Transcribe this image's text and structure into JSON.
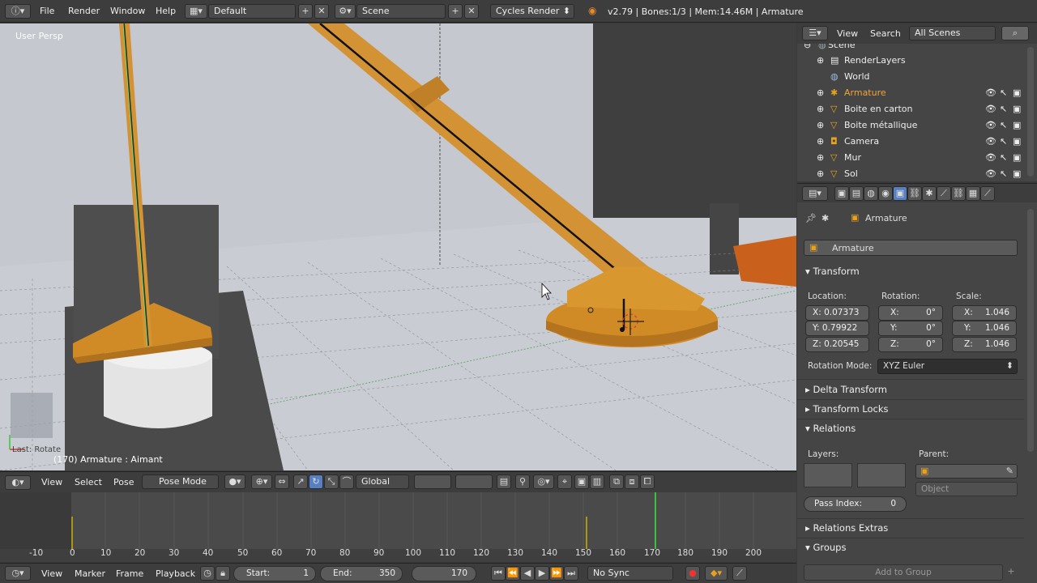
{
  "topbar": {
    "menus": [
      "File",
      "Render",
      "Window",
      "Help"
    ],
    "screen_layout": "Default",
    "scene": "Scene",
    "render_engine": "Cycles Render",
    "stats": "v2.79 | Bones:1/3 | Mem:14.46M | Armature"
  },
  "viewport": {
    "view_label": "User Persp",
    "last_op": "Last: Rotate",
    "object_info": "(170) Armature : Aimant"
  },
  "viewport_header": {
    "menus": [
      "View",
      "Select",
      "Pose"
    ],
    "mode": "Pose Mode",
    "orientation": "Global"
  },
  "timeline": {
    "ticks": [
      "-10",
      "0",
      "10",
      "20",
      "30",
      "40",
      "50",
      "60",
      "70",
      "80",
      "90",
      "100",
      "110",
      "120",
      "130",
      "140",
      "150",
      "160",
      "170",
      "180",
      "190",
      "200"
    ],
    "menus": [
      "View",
      "Marker",
      "Frame",
      "Playback"
    ],
    "start_label": "Start:",
    "start_value": "1",
    "end_label": "End:",
    "end_value": "350",
    "current_frame": "170",
    "sync": "No Sync"
  },
  "outliner": {
    "menus": [
      "View",
      "Search"
    ],
    "filter": "All Scenes",
    "items": [
      {
        "label": "Scene"
      },
      {
        "label": "RenderLayers"
      },
      {
        "label": "World"
      },
      {
        "label": "Armature"
      },
      {
        "label": "Boite en carton"
      },
      {
        "label": "Boite métallique"
      },
      {
        "label": "Camera"
      },
      {
        "label": "Mur"
      },
      {
        "label": "Sol"
      }
    ]
  },
  "properties": {
    "breadcrumb": "Armature",
    "object_name": "Armature",
    "transform": {
      "title": "Transform",
      "location_label": "Location:",
      "rotation_label": "Rotation:",
      "scale_label": "Scale:",
      "location": [
        "X: 0.07373",
        "Y: 0.79922",
        "Z: 0.20545"
      ],
      "rotation": [
        {
          "axis": "X:",
          "value": "0°"
        },
        {
          "axis": "Y:",
          "value": "0°"
        },
        {
          "axis": "Z:",
          "value": "0°"
        }
      ],
      "scale": [
        {
          "axis": "X:",
          "value": "1.046"
        },
        {
          "axis": "Y:",
          "value": "1.046"
        },
        {
          "axis": "Z:",
          "value": "1.046"
        }
      ],
      "rotation_mode_label": "Rotation Mode:",
      "rotation_mode": "XYZ Euler"
    },
    "panels": {
      "delta": "Delta Transform",
      "locks": "Transform Locks",
      "relations": "Relations",
      "layers_label": "Layers:",
      "parent_label": "Parent:",
      "parent_type": "Object",
      "pass_index_label": "Pass Index:",
      "pass_index": "0",
      "relations_extras": "Relations Extras",
      "groups": "Groups",
      "add_to_group": "Add to Group"
    }
  },
  "colors": {
    "orange": "#d98c1e",
    "wood": "#c98a2c",
    "viewport_bg": "#c4c8d0",
    "panel": "#454545",
    "header": "#3d3d3d",
    "accent_blue": "#5680c2"
  }
}
